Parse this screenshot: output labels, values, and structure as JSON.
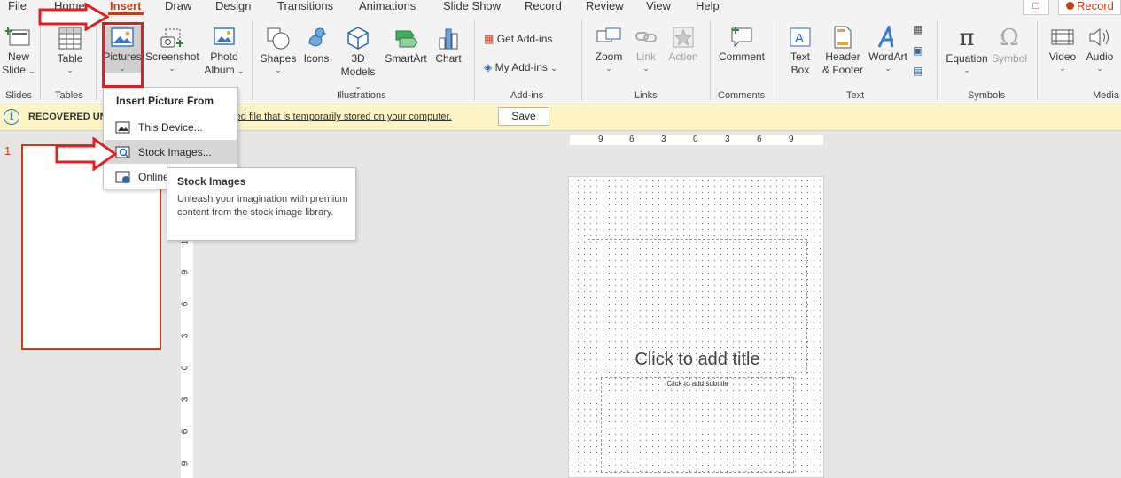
{
  "tabs": {
    "items": [
      "File",
      "Home",
      "Insert",
      "Draw",
      "Design",
      "Transitions",
      "Animations",
      "Slide Show",
      "Record",
      "Review",
      "View",
      "Help"
    ],
    "active": "Insert",
    "record_label": "Record"
  },
  "ribbon": {
    "slides": {
      "new_slide": "New",
      "new_slide2": "Slide",
      "group": "Slides"
    },
    "tables": {
      "table": "Table",
      "group": "Tables"
    },
    "images": {
      "pictures": "Pictures",
      "screenshot": "Screenshot",
      "photo_album": "Photo",
      "photo_album2": "Album"
    },
    "illustrations": {
      "shapes": "Shapes",
      "icons": "Icons",
      "models": "3D",
      "models2": "Models",
      "smartart": "SmartArt",
      "chart": "Chart",
      "group": "Illustrations"
    },
    "addins": {
      "get": "Get Add-ins",
      "my": "My Add-ins",
      "group": "Add-ins"
    },
    "links": {
      "zoom": "Zoom",
      "link": "Link",
      "action": "Action",
      "group": "Links"
    },
    "comments": {
      "comment": "Comment",
      "group": "Comments"
    },
    "text": {
      "textbox": "Text",
      "textbox2": "Box",
      "header": "Header",
      "header2": "& Footer",
      "wordart": "WordArt",
      "group": "Text"
    },
    "symbols": {
      "equation": "Equation",
      "symbol": "Symbol",
      "group": "Symbols"
    },
    "media": {
      "video": "Video",
      "audio": "Audio",
      "group": "Media"
    }
  },
  "infobar": {
    "title": "RECOVERED UN",
    "message": "red file that is temporarily stored on your computer.",
    "save_label": "Save"
  },
  "thumbnail": {
    "number": "1"
  },
  "slide": {
    "title_placeholder": "Click to add title",
    "subtitle_placeholder": "Click to add subtitle"
  },
  "rulers": {
    "horizontal": [
      "9",
      "6",
      "3",
      "0",
      "3",
      "6",
      "9"
    ],
    "vertical": [
      "1",
      "9",
      "6",
      "3",
      "0",
      "3",
      "6",
      "9"
    ]
  },
  "dropdown": {
    "header": "Insert Picture From",
    "items": [
      "This Device...",
      "Stock Images...",
      "Online"
    ]
  },
  "tooltip": {
    "title": "Stock Images",
    "body": "Unleash your imagination with premium content from the stock image library."
  },
  "colors": {
    "accent": "#c43e1c",
    "annotation": "#e02020",
    "infobar": "#fcf4c4"
  }
}
